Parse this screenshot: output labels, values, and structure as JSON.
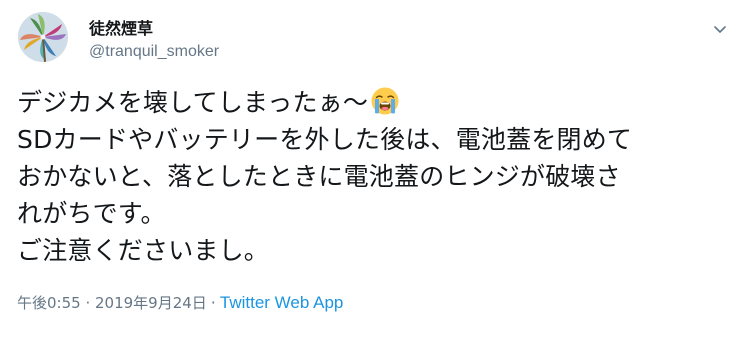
{
  "user": {
    "display_name": "徒然煙草",
    "handle": "@tranquil_smoker",
    "avatar_icon": "pinwheel-avatar"
  },
  "tweet": {
    "line1": "デジカメを壊してしまったぁ～",
    "emoji_icon": "loudly-crying-face-icon",
    "body": "SDカードやバッテリーを外した後は、電池蓋を閉めて\nおかないと、落としたときに電池蓋のヒンジが破壊さ\nれがちです。\nご注意くださいまし。"
  },
  "meta": {
    "timestamp": "午後0:55 · 2019年9月24日",
    "separator": "·",
    "source": "Twitter Web App"
  },
  "colors": {
    "text": "#14171a",
    "secondary": "#657786",
    "link": "#1b95e0"
  }
}
